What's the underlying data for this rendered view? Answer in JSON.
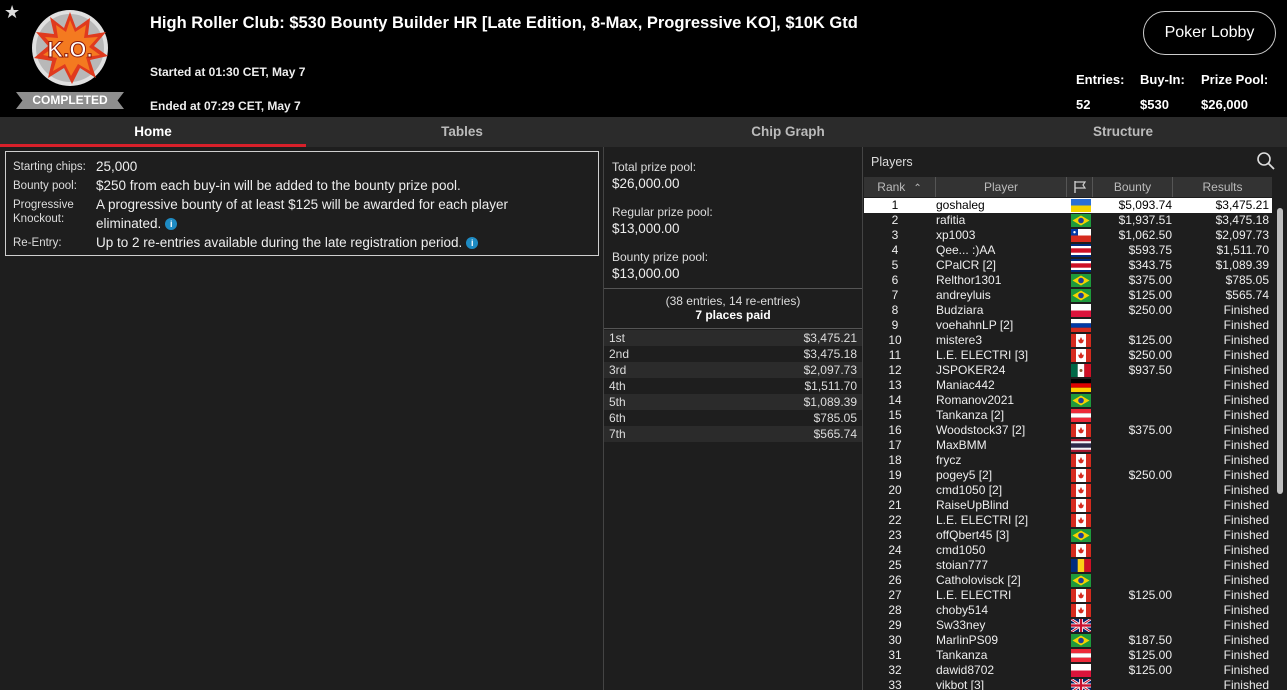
{
  "header": {
    "logo_text": "K.O.",
    "status_badge": "COMPLETED",
    "title": "High Roller Club: $530 Bounty Builder HR [Late Edition, 8-Max, Progressive KO], $10K Gtd",
    "started": "Started at 01:30 CET, May 7",
    "ended": "Ended at 07:29 CET, May 7",
    "lobby_button": "Poker Lobby",
    "stats": {
      "entries_label": "Entries:",
      "entries_value": "52",
      "buyin_label": "Buy-In:",
      "buyin_value": "$530",
      "prizepool_label": "Prize Pool:",
      "prizepool_value": "$26,000"
    }
  },
  "tabs": [
    "Home",
    "Tables",
    "Chip Graph",
    "Structure"
  ],
  "info": {
    "starting_chips_label": "Starting chips:",
    "starting_chips_value": "25,000",
    "bounty_pool_label": "Bounty pool:",
    "bounty_pool_value": "$250 from each buy-in will be added to the bounty prize pool.",
    "pko_label": "Progressive Knockout:",
    "pko_value": "A progressive bounty of at least $125 will be awarded for each player eliminated.",
    "reentry_label": "Re-Entry:",
    "reentry_value": "Up to 2 re-entries available during the late registration period."
  },
  "prize": {
    "total_label": "Total prize pool:",
    "total_value": "$26,000.00",
    "regular_label": "Regular prize pool:",
    "regular_value": "$13,000.00",
    "bounty_label": "Bounty prize pool:",
    "bounty_value": "$13,000.00",
    "entries_note": "(38 entries, 14 re-entries)",
    "places_paid": "7 places paid",
    "payouts": [
      {
        "place": "1st",
        "amount": "$3,475.21"
      },
      {
        "place": "2nd",
        "amount": "$3,475.18"
      },
      {
        "place": "3rd",
        "amount": "$2,097.73"
      },
      {
        "place": "4th",
        "amount": "$1,511.70"
      },
      {
        "place": "5th",
        "amount": "$1,089.39"
      },
      {
        "place": "6th",
        "amount": "$785.05"
      },
      {
        "place": "7th",
        "amount": "$565.74"
      }
    ]
  },
  "players": {
    "title": "Players",
    "columns": {
      "rank": "Rank",
      "player": "Player",
      "bounty": "Bounty",
      "results": "Results"
    },
    "rows": [
      {
        "rank": "1",
        "name": "goshaleg",
        "flag": "ukraine",
        "bounty": "$5,093.74",
        "result": "$3,475.21"
      },
      {
        "rank": "2",
        "name": "rafitia",
        "flag": "brazil",
        "bounty": "$1,937.51",
        "result": "$3,475.18"
      },
      {
        "rank": "3",
        "name": "xp1003",
        "flag": "chile",
        "bounty": "$1,062.50",
        "result": "$2,097.73"
      },
      {
        "rank": "4",
        "name": "Qee... :)AA",
        "flag": "costa-rica",
        "bounty": "$593.75",
        "result": "$1,511.70"
      },
      {
        "rank": "5",
        "name": "CPalCR [2]",
        "flag": "costa-rica",
        "bounty": "$343.75",
        "result": "$1,089.39"
      },
      {
        "rank": "6",
        "name": "Relthor1301",
        "flag": "brazil",
        "bounty": "$375.00",
        "result": "$785.05"
      },
      {
        "rank": "7",
        "name": "andreyluis",
        "flag": "brazil",
        "bounty": "$125.00",
        "result": "$565.74"
      },
      {
        "rank": "8",
        "name": "Budziara",
        "flag": "poland",
        "bounty": "$250.00",
        "result": "Finished"
      },
      {
        "rank": "9",
        "name": "voehahnLP [2]",
        "flag": "russia",
        "bounty": "",
        "result": "Finished"
      },
      {
        "rank": "10",
        "name": "mistere3",
        "flag": "canada",
        "bounty": "$125.00",
        "result": "Finished"
      },
      {
        "rank": "11",
        "name": "L.E. ELECTRI [3]",
        "flag": "canada",
        "bounty": "$250.00",
        "result": "Finished"
      },
      {
        "rank": "12",
        "name": "JSPOKER24",
        "flag": "mexico",
        "bounty": "$937.50",
        "result": "Finished"
      },
      {
        "rank": "13",
        "name": "Maniac442",
        "flag": "germany",
        "bounty": "",
        "result": "Finished"
      },
      {
        "rank": "14",
        "name": "Romanov2021",
        "flag": "brazil",
        "bounty": "",
        "result": "Finished"
      },
      {
        "rank": "15",
        "name": "Tankanza [2]",
        "flag": "austria",
        "bounty": "",
        "result": "Finished"
      },
      {
        "rank": "16",
        "name": "Woodstock37 [2]",
        "flag": "canada",
        "bounty": "$375.00",
        "result": "Finished"
      },
      {
        "rank": "17",
        "name": "MaxBMM",
        "flag": "thailand",
        "bounty": "",
        "result": "Finished"
      },
      {
        "rank": "18",
        "name": "frycz",
        "flag": "canada",
        "bounty": "",
        "result": "Finished"
      },
      {
        "rank": "19",
        "name": "pogey5 [2]",
        "flag": "canada",
        "bounty": "$250.00",
        "result": "Finished"
      },
      {
        "rank": "20",
        "name": "cmd1050 [2]",
        "flag": "canada",
        "bounty": "",
        "result": "Finished"
      },
      {
        "rank": "21",
        "name": "RaiseUpBlind",
        "flag": "canada",
        "bounty": "",
        "result": "Finished"
      },
      {
        "rank": "22",
        "name": "L.E. ELECTRI [2]",
        "flag": "canada",
        "bounty": "",
        "result": "Finished"
      },
      {
        "rank": "23",
        "name": "offQbert45 [3]",
        "flag": "brazil",
        "bounty": "",
        "result": "Finished"
      },
      {
        "rank": "24",
        "name": "cmd1050",
        "flag": "canada",
        "bounty": "",
        "result": "Finished"
      },
      {
        "rank": "25",
        "name": "stoian777",
        "flag": "romania",
        "bounty": "",
        "result": "Finished"
      },
      {
        "rank": "26",
        "name": "Catholovisck [2]",
        "flag": "brazil",
        "bounty": "",
        "result": "Finished"
      },
      {
        "rank": "27",
        "name": "L.E. ELECTRI",
        "flag": "canada",
        "bounty": "$125.00",
        "result": "Finished"
      },
      {
        "rank": "28",
        "name": "choby514",
        "flag": "canada",
        "bounty": "",
        "result": "Finished"
      },
      {
        "rank": "29",
        "name": "Sw33ney",
        "flag": "uk",
        "bounty": "",
        "result": "Finished"
      },
      {
        "rank": "30",
        "name": "MarlinPS09",
        "flag": "brazil",
        "bounty": "$187.50",
        "result": "Finished"
      },
      {
        "rank": "31",
        "name": "Tankanza",
        "flag": "austria",
        "bounty": "$125.00",
        "result": "Finished"
      },
      {
        "rank": "32",
        "name": "dawid8702",
        "flag": "poland",
        "bounty": "$125.00",
        "result": "Finished"
      },
      {
        "rank": "33",
        "name": "vikbot [3]",
        "flag": "uk",
        "bounty": "",
        "result": "Finished"
      }
    ]
  },
  "colors": {
    "accent": "#d8202a",
    "info_icon": "#1e8bc3",
    "highlight_row": "#ffffff"
  }
}
